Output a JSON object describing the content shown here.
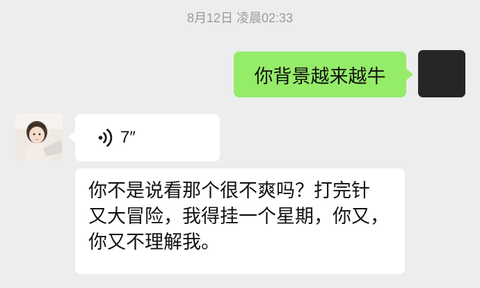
{
  "chat": {
    "timestamp": "8月12日 凌晨02:33",
    "messages": [
      {
        "side": "right",
        "type": "text",
        "text": "你背景越来越牛",
        "bubble_color": "#95ec69",
        "avatar": "dark-avatar"
      },
      {
        "side": "left",
        "type": "voice",
        "duration": "7″",
        "icon": "voice-wave-icon",
        "avatar": "child-photo-avatar"
      },
      {
        "side": "left",
        "type": "text",
        "lines": [
          "你不是说看那个很不爽吗？打完针",
          "又大冒险，我得挂一个星期，你又，",
          "你又不理解我。"
        ]
      }
    ]
  },
  "colors": {
    "background": "#ededed",
    "sent_bubble": "#95ec69",
    "received_bubble": "#ffffff",
    "timestamp_text": "#9b9b9b"
  }
}
